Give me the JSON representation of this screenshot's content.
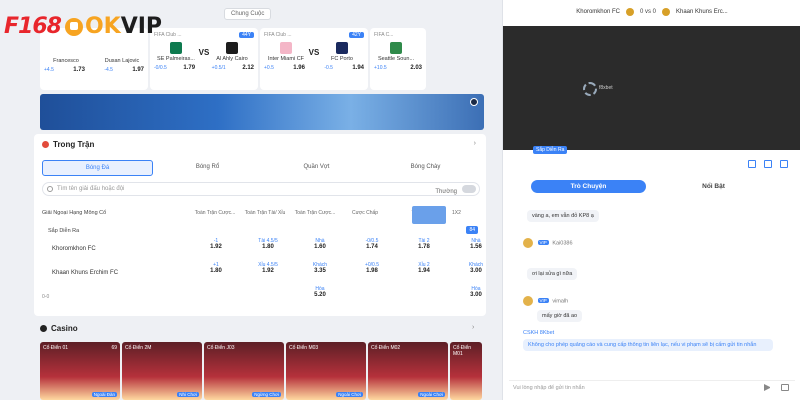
{
  "logos": {
    "f168": "F168",
    "okvip_ok": "OK",
    "okvip_vip": "VIP"
  },
  "top_tabs": [
    "Chung Cuộc"
  ],
  "match_cards": [
    {
      "league": "",
      "badge": "",
      "home": "Francesco",
      "away": "Dusan Lajovic",
      "odds": [
        {
          "t": "+4.5",
          "v": ""
        },
        {
          "t": "",
          "v": "1.73"
        },
        {
          "t": "-4.5",
          "v": ""
        },
        {
          "t": "",
          "v": "1.97"
        }
      ],
      "home_color": "#ffffff",
      "away_color": "#ffffff"
    },
    {
      "league": "FIFA Club ...",
      "badge": "44Y",
      "home": "SE Palmeiras...",
      "away": "Al Ahly Cairo",
      "odds": [
        {
          "t": "-0/0.5",
          "v": ""
        },
        {
          "t": "",
          "v": "1.79"
        },
        {
          "t": "+0.5/1",
          "v": ""
        },
        {
          "t": "",
          "v": "2.12"
        }
      ],
      "home_color": "#0e7a4f",
      "away_color": "#1d1d1d"
    },
    {
      "league": "FIFA Club ...",
      "badge": "42Y",
      "home": "Inter Miami CF",
      "away": "FC Porto",
      "odds": [
        {
          "t": "+0.5",
          "v": ""
        },
        {
          "t": "",
          "v": "1.96"
        },
        {
          "t": "-0.5",
          "v": ""
        },
        {
          "t": "",
          "v": "1.94"
        }
      ],
      "home_color": "#f4b6c7",
      "away_color": "#1a2a5e"
    },
    {
      "league": "FIFA C...",
      "badge": "",
      "home": "Seattle Soun...",
      "away": "",
      "odds": [
        {
          "t": "+10.5",
          "v": ""
        },
        {
          "t": "",
          "v": "2.03"
        }
      ],
      "home_color": "#2f8a4a",
      "away_color": "#ffffff"
    }
  ],
  "in_play": {
    "title": "Trong Trận",
    "sport_tabs": [
      "Bóng Đá",
      "Bóng Rổ",
      "Quần Vợt",
      "Bóng Chày"
    ],
    "search_placeholder": "Tìm tên giải đấu hoặc đội",
    "toggle_label": "Thường",
    "league": "Giải Ngoại Hạng Mông Cổ",
    "col_heads": [
      "Toàn Trận Cược...",
      "Toàn Trận Tài/ Xỉu",
      "Toàn Trận Cược...",
      "Cược Chấp",
      "Tài"
    ],
    "col_12": "1X2",
    "live_label": "Sắp Diễn Ra",
    "live_badge": "84",
    "team_home": "Khoromkhon FC",
    "team_away": "Khaan Khuns Erchim FC",
    "rows": [
      [
        {
          "t": "-1",
          "v": "1.92"
        },
        {
          "t": "Tài 4.5/5",
          "v": "1.80"
        },
        {
          "t": "Nhà",
          "v": "1.60"
        },
        {
          "t": "-0/0.5",
          "v": "1.74"
        },
        {
          "t": "Tài 2",
          "v": "1.78"
        },
        {
          "t": "Nhà",
          "v": "1.56"
        }
      ],
      [
        {
          "t": "+1",
          "v": "1.80"
        },
        {
          "t": "Xỉu 4.5/5",
          "v": "1.92"
        },
        {
          "t": "Khách",
          "v": "3.35"
        },
        {
          "t": "+0/0.5",
          "v": "1.98"
        },
        {
          "t": "Xỉu 2",
          "v": "1.94"
        },
        {
          "t": "Khách",
          "v": "3.00"
        }
      ],
      [
        {
          "t": "",
          "v": ""
        },
        {
          "t": "",
          "v": ""
        },
        {
          "t": "Hòa",
          "v": "5.20"
        },
        {
          "t": "",
          "v": ""
        },
        {
          "t": "",
          "v": ""
        },
        {
          "t": "Hòa",
          "v": "3.00"
        }
      ]
    ],
    "score_extra": "0-0"
  },
  "casino": {
    "title": "Casino",
    "cards": [
      {
        "name": "Cổ Điển 01",
        "count": "69",
        "tag": "Ngoài Đàn"
      },
      {
        "name": "Cổ Điển 2M",
        "count": "",
        "tag": "Nhi Chơi"
      },
      {
        "name": "Cổ Điển J03",
        "count": "",
        "tag": "Ngừng Chơi"
      },
      {
        "name": "Cổ Điển M03",
        "count": "",
        "tag": "Ngoài Chơi"
      },
      {
        "name": "Cổ Điển M02",
        "count": "",
        "tag": "Ngoài Chơi"
      },
      {
        "name": "Cổ Điển M01",
        "count": "",
        "tag": "Nhi Chơi"
      }
    ]
  },
  "stream": {
    "home": "Khoromkhon FC",
    "score": "0 vs 0",
    "away": "Khaan Khuns Erc...",
    "spinner_text": "f8xbet",
    "live_tag": "Sắp Diễn Ra"
  },
  "chat": {
    "tabs": [
      "Trò Chuyện",
      "Nổi Bật"
    ],
    "messages": [
      {
        "user": "",
        "text": "vàng a, em vẫn đỏ KP8 ạ",
        "style": "grey"
      },
      {
        "user": "Kai0386",
        "text": "",
        "style": "grey"
      },
      {
        "user": "",
        "text": "ơi lại sửa gì nữa",
        "style": "grey"
      },
      {
        "user": "vimalh",
        "text": "mấy giờ đã ao",
        "style": "grey"
      },
      {
        "user": "CSKH 8Kbet",
        "text": "Không cho phép quảng cáo và cung cấp thông tin liên lạc, nếu vi phạm sẽ bị cấm gửi tin nhắn",
        "style": "blue"
      }
    ],
    "input_placeholder": "Vui lòng nhập để gửi tin nhắn"
  }
}
